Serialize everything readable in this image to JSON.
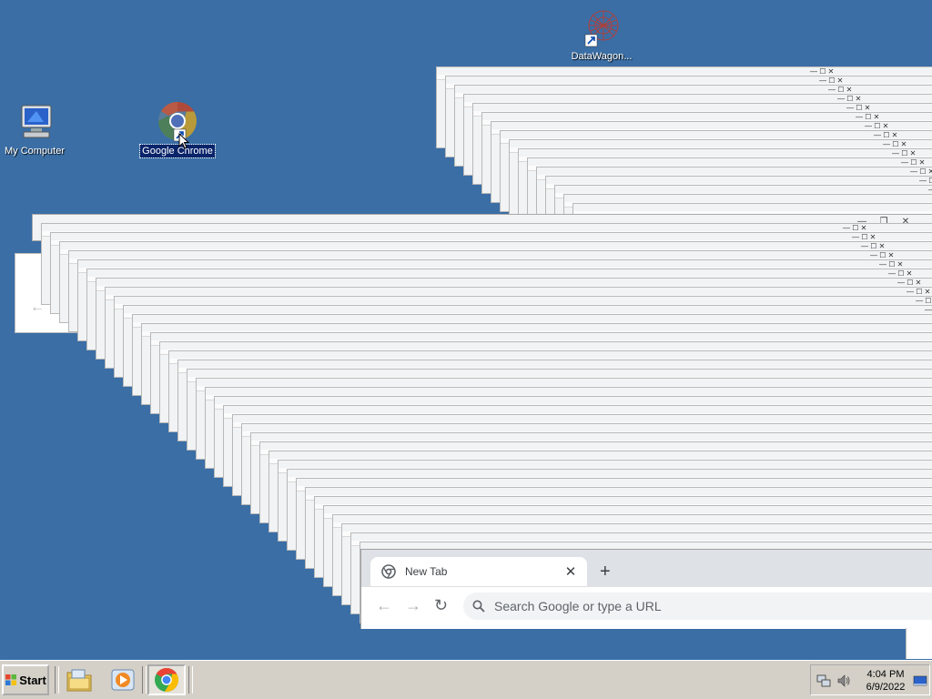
{
  "desktop": {
    "icons": [
      {
        "label": "DataWagon..."
      },
      {
        "label": "My Computer"
      },
      {
        "label": "Google Chrome"
      }
    ]
  },
  "chrome": {
    "tab_title": "New Tab",
    "omnibox_placeholder": "Search Google or type a URL"
  },
  "taskbar": {
    "start_label": "Start",
    "time": "4:04 PM",
    "date": "6/9/2022"
  },
  "colors": {
    "desktop": "#3a6ea5",
    "taskbar": "#d4d0c8",
    "selection": "#0a246a"
  }
}
